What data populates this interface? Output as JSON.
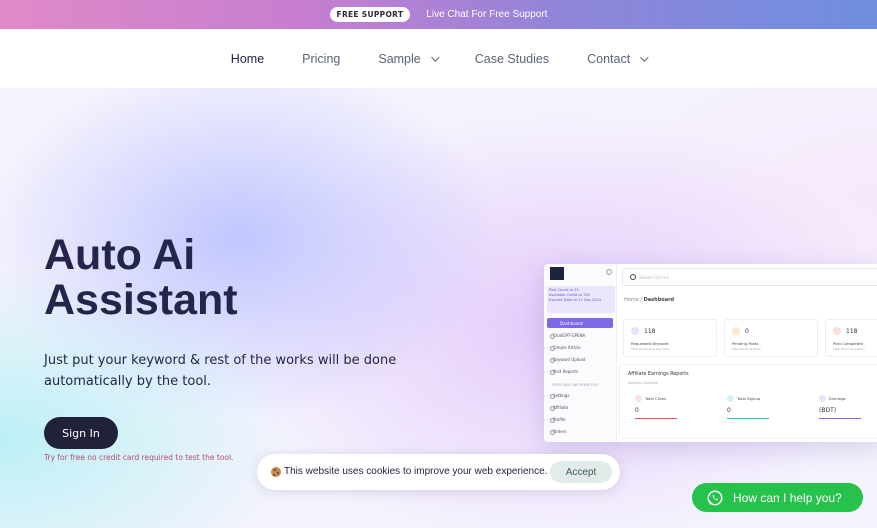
{
  "topbar": {
    "badge": "FREE SUPPORT",
    "text": "Live Chat For Free Support"
  },
  "nav": {
    "items": [
      {
        "label": "Home",
        "active": true
      },
      {
        "label": "Pricing"
      },
      {
        "label": "Sample",
        "dropdown": true
      },
      {
        "label": "Case Studies"
      },
      {
        "label": "Contact",
        "dropdown": true
      }
    ]
  },
  "hero": {
    "title_line1": "Auto Ai",
    "title_line2": "Assistant",
    "subtitle": "Just put your keyword & rest of the works will be done automatically by the tool.",
    "cta": "Sign In",
    "trial_note": "Try for free no credit card required to test the tool."
  },
  "dashboard": {
    "notice": [
      "Post Count to 25",
      "Available Credit to 700",
      "Expired Date to 21 Sep 2024"
    ],
    "menu_active": "Dashboard",
    "menu": [
      "ChatGPT-GPENA",
      "Simple Article",
      "Keyword Upload",
      "Post Reports"
    ],
    "section": "PERSONAL INFORMATION",
    "menu2": [
      "Settings",
      "Affiliate",
      "Profile",
      "Orders"
    ],
    "search_placeholder": "Search (Ctrl+/)",
    "breadcrumb_home": "Home / ",
    "breadcrumb_current": "Dashboard",
    "cards": [
      {
        "value": "118",
        "label": "Requested Keyword",
        "sub": "Total Requested Keyword",
        "color": "#7c69e6"
      },
      {
        "value": "0",
        "label": "Pending Posts",
        "sub": "Total Pending Posts",
        "color": "#f2a43b"
      },
      {
        "value": "118",
        "label": "Post Completed",
        "sub": "Total Post Completed",
        "color": "#ef6b6b"
      }
    ],
    "affiliate_title": "Affiliate Earnings Reports",
    "affiliate_sub": "Earnings Overview",
    "stats": [
      {
        "label": "Total Clicks",
        "value": "0",
        "color": "#ef5a5a"
      },
      {
        "label": "Total Signup",
        "value": "0",
        "color": "#27c3d6"
      },
      {
        "label": "Earnings",
        "value": "(BDT)",
        "color": "#7c69e6"
      }
    ]
  },
  "cookie": {
    "text": "This website uses cookies to improve your web experience.",
    "accept": "Accept"
  },
  "whatsapp": {
    "label": "How can I help you?"
  },
  "colors": {
    "brand_dark": "#1f2239",
    "accent": "#7c69e6",
    "whatsapp": "#27c24b"
  }
}
